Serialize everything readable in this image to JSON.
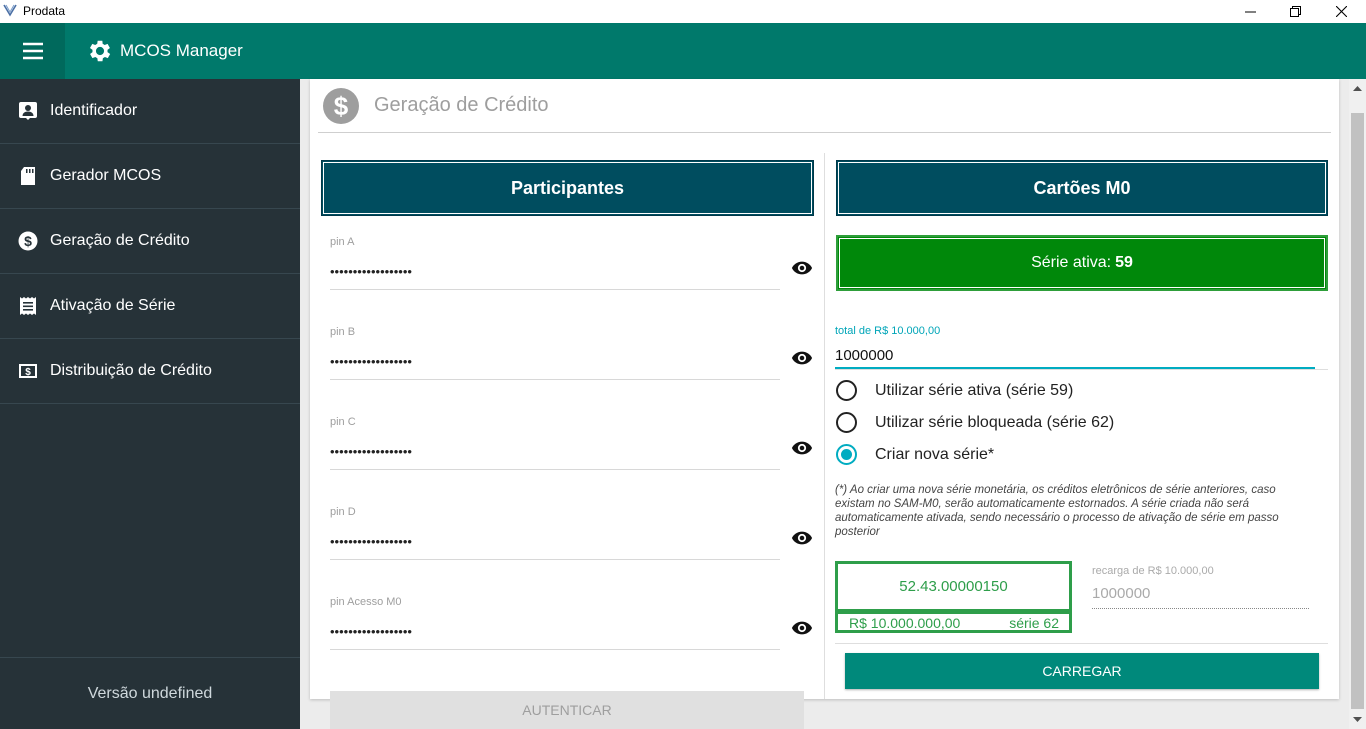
{
  "window": {
    "title": "Prodata"
  },
  "appbar": {
    "title": "MCOS Manager"
  },
  "sidebar": {
    "items": [
      {
        "label": "Identificador",
        "icon": "id-badge-icon"
      },
      {
        "label": "Gerador MCOS",
        "icon": "sd-card-icon"
      },
      {
        "label": "Geração de Crédito",
        "icon": "dollar-circle-icon"
      },
      {
        "label": "Ativação de Série",
        "icon": "receipt-icon"
      },
      {
        "label": "Distribuição de Crédito",
        "icon": "money-icon"
      }
    ],
    "version": "Versão undefined"
  },
  "page": {
    "title": "Geração de Crédito"
  },
  "participantes": {
    "title": "Participantes",
    "fields": [
      {
        "label": "pin A",
        "value": "••••••••••••••••••"
      },
      {
        "label": "pin B",
        "value": "••••••••••••••••••"
      },
      {
        "label": "pin C",
        "value": "••••••••••••••••••"
      },
      {
        "label": "pin D",
        "value": "••••••••••••••••••"
      },
      {
        "label": "pin Acesso M0",
        "value": "••••••••••••••••••"
      }
    ],
    "auth_button": "AUTENTICAR"
  },
  "cartoes": {
    "title": "Cartões M0",
    "serie_ativa_label": "Série ativa:",
    "serie_ativa_value": "59",
    "total_label": "total de R$ 10.000,00",
    "total_value": "1000000",
    "options": [
      {
        "label": "Utilizar série ativa (série 59)",
        "checked": false
      },
      {
        "label": "Utilizar série bloqueada (série 62)",
        "checked": false
      },
      {
        "label": "Criar nova série*",
        "checked": true
      }
    ],
    "note": "(*) Ao criar uma nova série monetária, os créditos eletrônicos de série anteriores, caso existam no SAM-M0, serão automaticamente estornados. A série criada não será automaticamente ativada, sendo necessário o processo de ativação de série em passo posterior",
    "card": {
      "number": "52.43.00000150",
      "amount": "R$ 10.000.000,00",
      "serie": "série 62"
    },
    "recarga_label": "recarga de R$ 10.000,00",
    "recarga_value": "1000000",
    "carregar_button": "CARREGAR"
  },
  "colors": {
    "primary": "#00796b",
    "sidebar": "#263238",
    "panel": "#004d5f",
    "success": "#00880a",
    "accent": "#00acc1"
  }
}
